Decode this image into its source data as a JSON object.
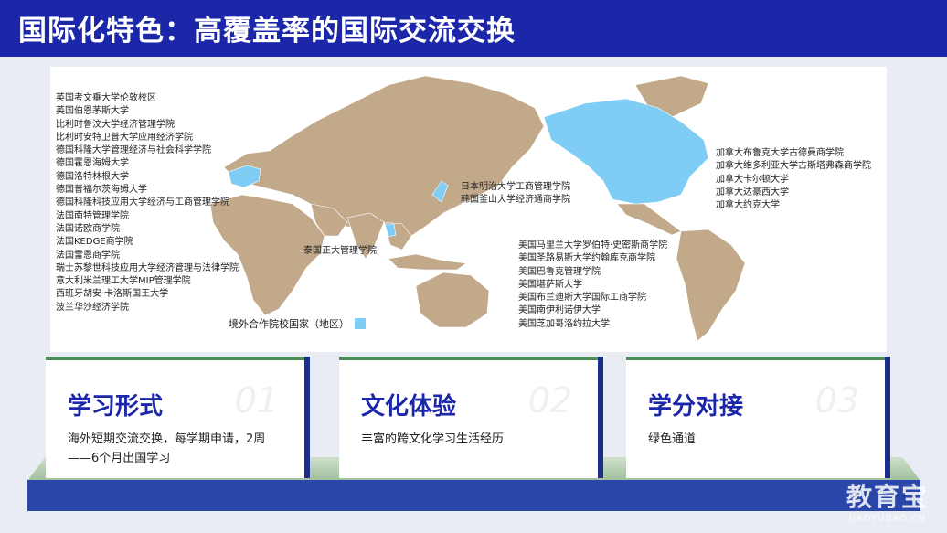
{
  "header": {
    "title": "国际化特色：高覆盖率的国际交流交换"
  },
  "map": {
    "legend_label": "境外合作院校国家（地区）",
    "legend_color": "#7fcdf5",
    "land_color": "#c2a98a",
    "europe_labels": [
      "英国考文垂大学伦敦校区",
      "英国伯恩茅斯大学",
      "比利时鲁汶大学经济管理学院",
      "比利时安特卫普大学应用经济学院",
      "德国科隆大学管理经济与社会科学学院",
      "德国霍恩海姆大学",
      "德国洛特林根大学",
      "德国普福尔茨海姆大学",
      "德国科隆科技应用大学经济与工商管理学院",
      "法国南特管理学院",
      "法国诺欧商学院",
      "法国KEDGE商学院",
      "法国雷恩商学院",
      "瑞士苏黎世科技应用大学经济管理与法律学院",
      "意大利米兰理工大学MIP管理学院",
      "西班牙胡安·卡洛斯国王大学",
      "波兰华沙经济学院"
    ],
    "thailand_label": "泰国正大管理学院",
    "east_asia_labels": [
      "日本明治大学工商管理学院",
      "韩国釜山大学经济通商学院"
    ],
    "usa_labels": [
      "美国马里兰大学罗伯特·史密斯商学院",
      "美国圣路易斯大学约翰库克商学院",
      "美国巴鲁克管理学院",
      "美国堪萨斯大学",
      "美国布兰迪斯大学国际工商学院",
      "美国南伊利诺伊大学",
      "美国芝加哥洛约拉大学"
    ],
    "canada_labels": [
      "加拿大布鲁克大学古德曼商学院",
      "加拿大维多利亚大学古斯塔弗森商学院",
      "加拿大卡尔顿大学",
      "加拿大达豪西大学",
      "加拿大约克大学"
    ]
  },
  "cards": [
    {
      "title": "学习形式",
      "number": "01",
      "text": "海外短期交流交换，每学期申请，2周——6个月出国学习"
    },
    {
      "title": "文化体验",
      "number": "02",
      "text": "丰富的跨文化学习生活经历"
    },
    {
      "title": "学分对接",
      "number": "03",
      "text": "绿色通道"
    }
  ],
  "watermark": {
    "main": "教育宝",
    "sub": "JIAOYUBAO.CN"
  }
}
